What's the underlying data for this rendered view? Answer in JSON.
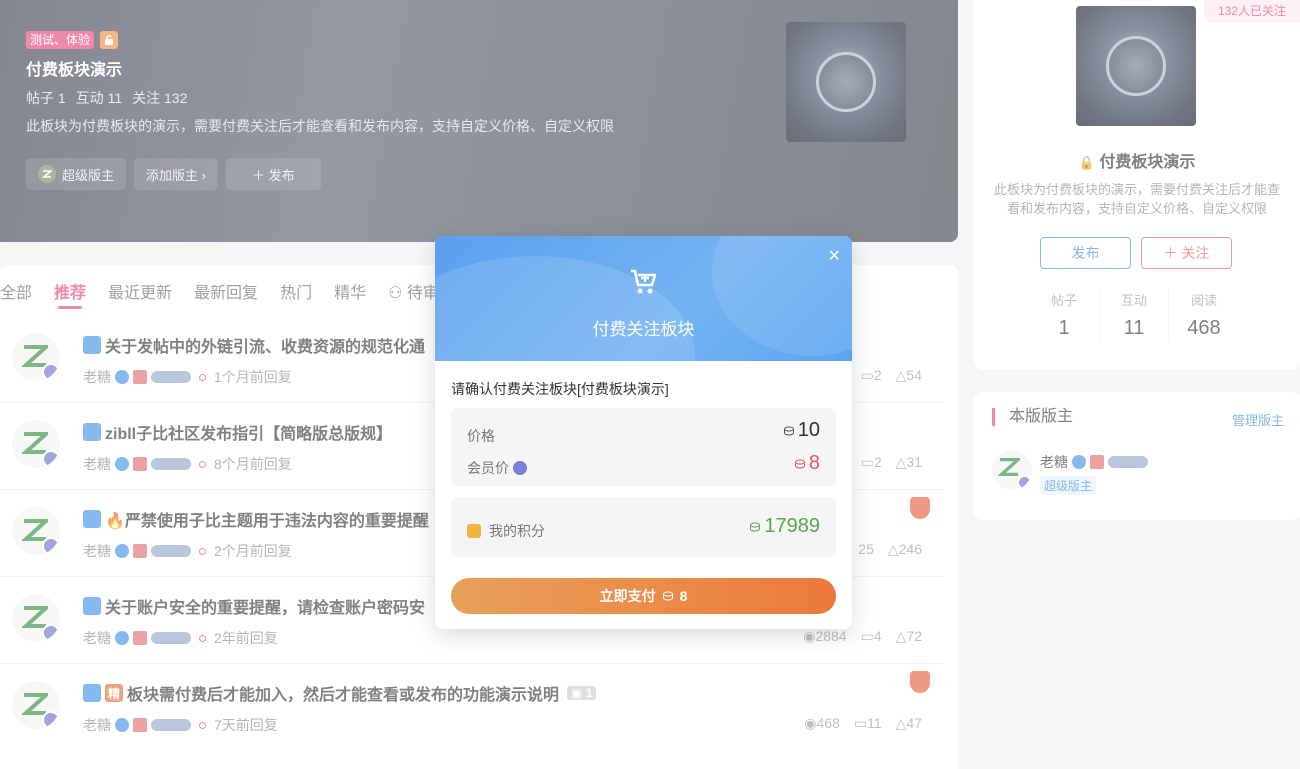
{
  "banner": {
    "tag": "测试、体验",
    "title": "付费板块演示",
    "stats": [
      "帖子 1",
      "互动 11",
      "关注 132"
    ],
    "desc": "此板块为付费板块的演示，需要付费关注后才能查看和发布内容，支持自定义价格、自定义权限",
    "buttons": {
      "moderator": "超级版主",
      "add_moderator": "添加版主 ›",
      "publish": "＋ 发布"
    }
  },
  "tabs": [
    "全部",
    "推荐",
    "最近更新",
    "最新回复",
    "热门",
    "精华",
    "待审"
  ],
  "posts": [
    {
      "title": "关于发帖中的外链引流、收费资源的规范化通",
      "author": "老糖",
      "time": "1个月前回复",
      "stats": [
        "2",
        "54"
      ],
      "hot": false
    },
    {
      "title": "zibll子比社区发布指引【简略版总版规】",
      "author": "老糖",
      "time": "8个月前回复",
      "stats": [
        "2",
        "31"
      ],
      "hot": false
    },
    {
      "title": "🔥严禁使用子比主题用于违法内容的重要提醒",
      "author": "老糖",
      "time": "2个月前回复",
      "stats": [
        "25",
        "246"
      ],
      "hot": true
    },
    {
      "title": "关于账户安全的重要提醒，请检查账户密码安",
      "author": "老糖",
      "time": "2年前回复",
      "stats": [
        "2884",
        "4",
        "72"
      ],
      "hot": false
    },
    {
      "title": "板块需付费后才能加入，然后才能查看或发布的功能演示说明",
      "author": "老糖",
      "time": "7天前回复",
      "stats": [
        "468",
        "11",
        "47"
      ],
      "hot": true,
      "jing": "精",
      "img_count": "1"
    }
  ],
  "sidebar": {
    "follow_count": "132人已关注",
    "title": "付费板块演示",
    "desc": "此板块为付费板块的演示，需要付费关注后才能查看和发布内容，支持自定义价格、自定义权限",
    "publish": "发布",
    "follow": "＋ 关注",
    "stats": [
      {
        "label": "帖子",
        "value": "1"
      },
      {
        "label": "互动",
        "value": "11"
      },
      {
        "label": "阅读",
        "value": "468"
      }
    ]
  },
  "moderators": {
    "title": "本版版主",
    "manage": "管理版主",
    "name": "老糖",
    "role": "超级版主"
  },
  "modal": {
    "title": "付费关注板块",
    "close": "×",
    "confirm": "请确认付费关注板块[付费板块演示]",
    "price_label": "价格",
    "price": "10",
    "vip_label": "会员价",
    "vip_price": "8",
    "points_label": "我的积分",
    "points": "17989",
    "pay_label": "立即支付",
    "pay_amount": "8"
  },
  "colors": {
    "accent": "#e4407a",
    "blue": "#3a8ee6",
    "pay": "#ec7a3a",
    "points": "#5aa84a"
  }
}
